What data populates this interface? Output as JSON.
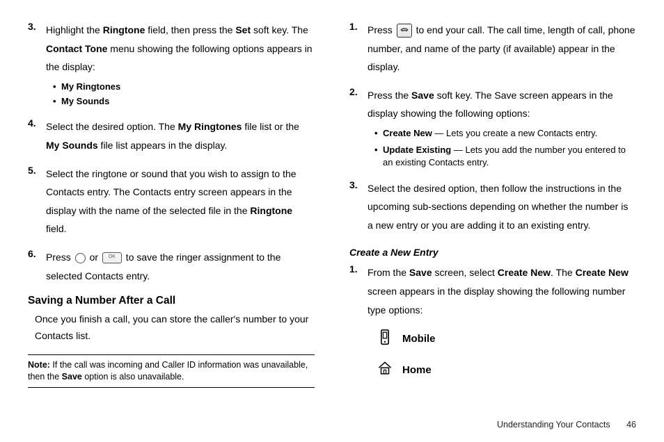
{
  "left": {
    "step3_a": "Highlight the ",
    "step3_field": "Ringtone",
    "step3_b": " field, then press the ",
    "step3_key": "Set",
    "step3_c": " soft key. The ",
    "step3_menu": "Contact Tone",
    "step3_d": " menu showing the following options appears in the display:",
    "sub1": "My Ringtones",
    "sub2": "My Sounds",
    "step4_a": "Select the desired option. The ",
    "step4_b1": "My Ringtones",
    "step4_b": " file list or the ",
    "step4_b2": "My Sounds",
    "step4_c": " file list appears in the display.",
    "step5_a": "Select the ringtone or sound that you wish to assign to the Contacts entry. The Contacts entry screen appears in the display with the name of the selected file in the ",
    "step5_b": "Ringtone",
    "step5_c": " field.",
    "step6_a": "Press ",
    "step6_or": " or ",
    "step6_b": " to save the ringer assignment to the selected Contacts entry.",
    "section": "Saving a Number After a Call",
    "para": "Once you finish a call, you can store the caller's number to your Contacts list.",
    "note_label": "Note:",
    "note_a": " If the call was incoming and Caller ID information was unavailable, then the ",
    "note_b": "Save",
    "note_c": " option is also unavailable."
  },
  "right": {
    "step1_a": "Press ",
    "step1_b": " to end your call. The call time, length of call, phone number, and name of the party (if available) appear in the display.",
    "step2_a": "Press the ",
    "step2_key": "Save",
    "step2_b": " soft key. The Save screen appears in the display showing the following options:",
    "opt1_name": "Create New",
    "opt1_desc": " — Lets you create a new Contacts entry.",
    "opt2_name": "Update Existing",
    "opt2_desc": " — Lets you add the number you entered to an existing Contacts entry.",
    "step3": "Select the desired option, then follow the instructions in the upcoming sub-sections depending on whether the number is a new entry or you are adding it to an existing entry.",
    "subsection": "Create a New Entry",
    "cstep1_a": "From the ",
    "cstep1_b1": "Save",
    "cstep1_b": " screen, select ",
    "cstep1_b2": "Create New",
    "cstep1_c": ". The ",
    "cstep1_b3": "Create New",
    "cstep1_d": " screen appears in the display showing the following number type options:",
    "type1": "Mobile",
    "type2": "Home"
  },
  "footer": {
    "chapter": "Understanding Your Contacts",
    "page": "46"
  }
}
